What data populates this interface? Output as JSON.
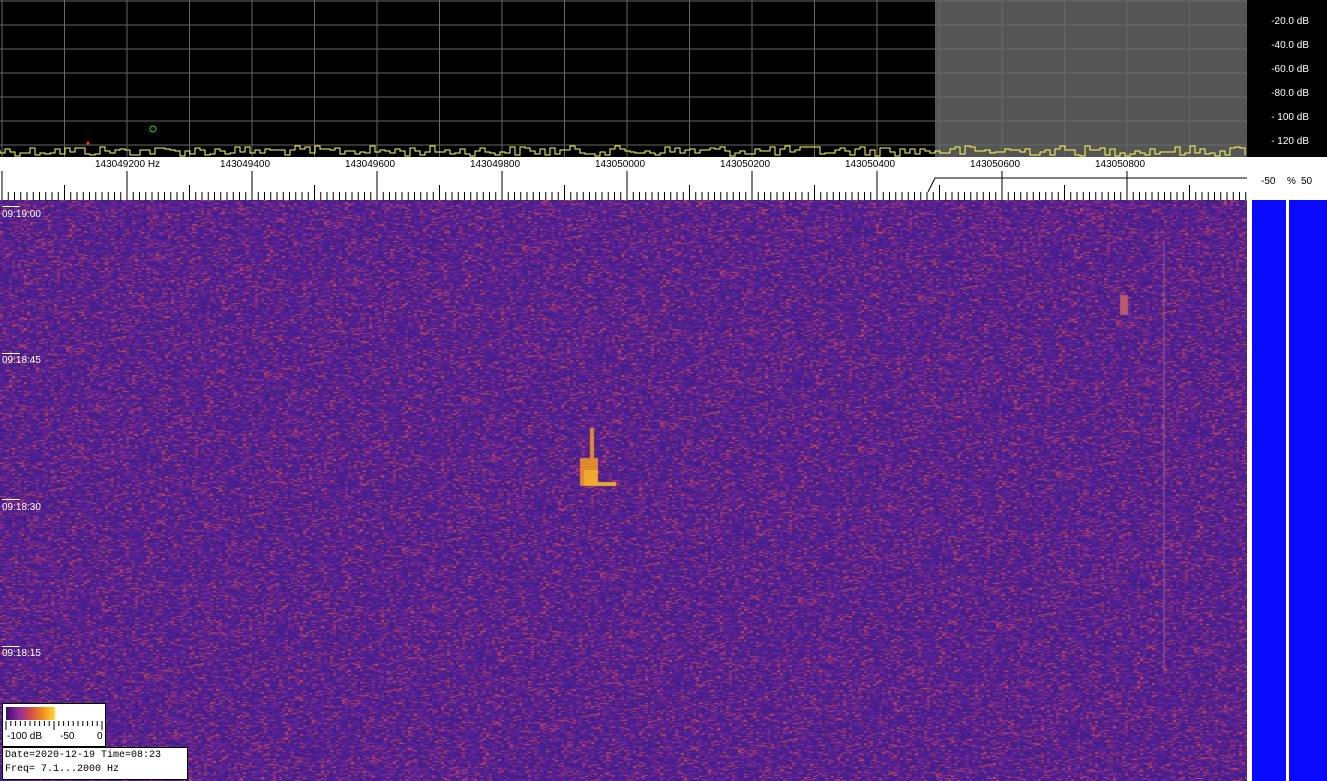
{
  "spectrum": {
    "db_scale": [
      "-20.0 dB",
      "-40.0 dB",
      "-60.0 dB",
      "-80.0 dB",
      "- 100 dB",
      "- 120 dB"
    ],
    "trace_color": "#ffff55",
    "grid_color": "#666666",
    "shade_color": "#555555"
  },
  "freq_axis": {
    "labels": [
      "143049200 Hz",
      "143049400",
      "143049600",
      "143049800",
      "143050000",
      "143050200",
      "143050400",
      "143050600",
      "143050800"
    ]
  },
  "pct_header": {
    "minus": "-50",
    "pct": "%",
    "plus": "50"
  },
  "waterfall": {
    "time_labels": [
      "09:19:00",
      "09:18:45",
      "09:18:30",
      "09:18:15"
    ],
    "background_color": "#4a1c8a"
  },
  "colorbar": {
    "min": "-100 dB",
    "mid": "-50",
    "max": "0"
  },
  "info": {
    "line1": "Date=2020-12-19 Time=08:23",
    "line2": "Freq= 7.1...2000 Hz"
  },
  "side_bar_color": "#0a0aff"
}
